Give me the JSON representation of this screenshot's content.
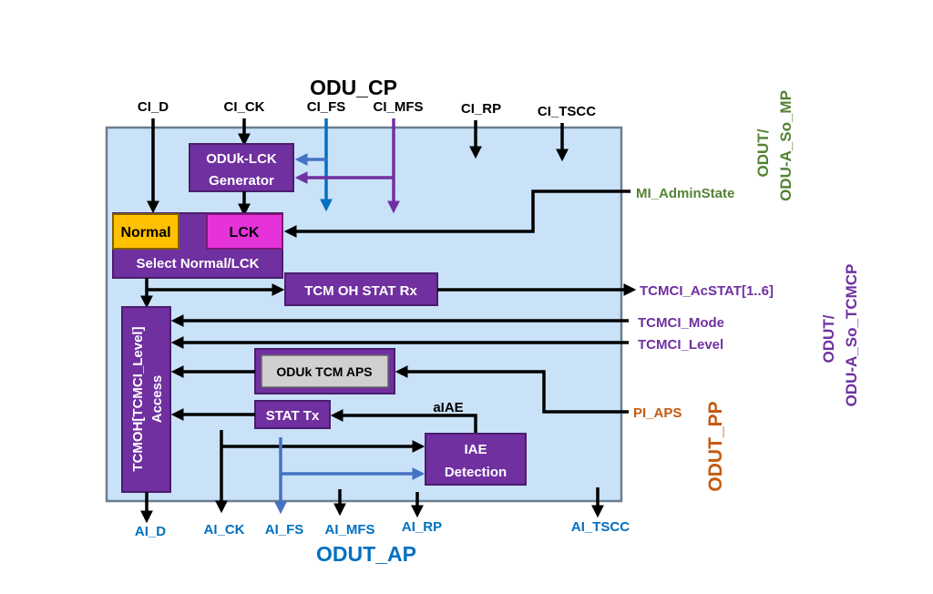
{
  "title_top": "ODU_CP",
  "title_bottom": "ODUT_AP",
  "colors": {
    "box_fill": "#c9e2f8",
    "purple": "#7030a0",
    "green": "#548235",
    "orange": "#c55a11",
    "blue": "#0070c0",
    "normal": "#ffc000",
    "lck": "#e633d9"
  },
  "inputs_top": [
    "CI_D",
    "CI_CK",
    "CI_FS",
    "CI_MFS",
    "CI_RP",
    "CI_TSCC"
  ],
  "outputs_bottom": [
    "AI_D",
    "AI_CK",
    "AI_FS",
    "AI_MFS",
    "AI_RP",
    "AI_TSCC"
  ],
  "blocks": {
    "lck_gen_1": "ODUk-LCK",
    "lck_gen_2": "Generator",
    "normal": "Normal",
    "lck": "LCK",
    "select": "Select Normal/LCK",
    "stat_rx": "TCM OH STAT Rx",
    "tcmoh_1": "TCMOH[TCMCI_Level]",
    "tcmoh_2": "Access",
    "aps": "ODUk TCM APS",
    "stat_tx": "STAT Tx",
    "iae_1": "IAE",
    "iae_2": "Detection",
    "aiae": "aIAE"
  },
  "right_signals": {
    "mi_admin": "MI_AdminState",
    "acstat": "TCMCI_AcSTAT[1..6]",
    "mode": "TCMCI_Mode",
    "level": "TCMCI_Level",
    "pi_aps": "PI_APS"
  },
  "side_labels": {
    "mp_1": "ODUT/",
    "mp_2": "ODU-A_So_MP",
    "tcmcp_1": "ODUT/",
    "tcmcp_2": "ODU-A_So_TCMCP",
    "pp": "ODUT_PP"
  }
}
